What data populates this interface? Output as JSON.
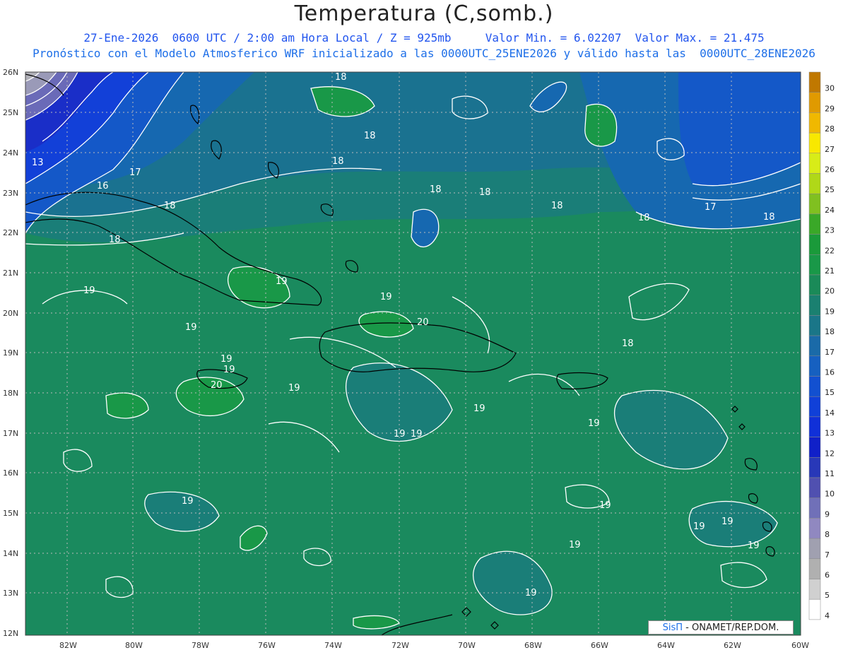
{
  "title": "Temperatura (C,somb.)",
  "subtitle_line1": "27-Ene-2026  0600 UTC / 2:00 am Hora Local / Z = 925mb     Valor Min. = 6.02207  Valor Max. = 21.475",
  "subtitle_line2": "Pronóstico con el Modelo Atmosferico WRF inicializado a las 0000UTC_25ENE2026 y válido hasta las  0000UTC_28ENE2026",
  "credit": {
    "sis": "SisΠ",
    "rest": " - ONAMET/REP.DOM."
  },
  "lat_labels": [
    "26N",
    "25N",
    "24N",
    "23N",
    "22N",
    "21N",
    "20N",
    "19N",
    "18N",
    "17N",
    "16N",
    "15N",
    "14N",
    "13N",
    "12N"
  ],
  "lon_labels": [
    "82W",
    "80W",
    "78W",
    "76W",
    "74W",
    "72W",
    "70W",
    "68W",
    "66W",
    "64W",
    "62W",
    "60W"
  ],
  "colorbar": {
    "levels": [
      "30",
      "29",
      "28",
      "27",
      "26",
      "25",
      "24",
      "23",
      "22",
      "21",
      "20",
      "19",
      "18",
      "17",
      "16",
      "15",
      "14",
      "13",
      "12",
      "11",
      "10",
      "9",
      "8",
      "7",
      "6",
      "5",
      "4"
    ],
    "colors": [
      "#c07800",
      "#e09a00",
      "#f0b800",
      "#f8e800",
      "#d8ec18",
      "#b0d818",
      "#80c020",
      "#3aa828",
      "#1a9a3a",
      "#199848",
      "#1a8a58",
      "#1a8070",
      "#1a7688",
      "#1a6aa8",
      "#1660c0",
      "#1250d0",
      "#1040d8",
      "#1030d8",
      "#1020c8",
      "#2838b8",
      "#5050b0",
      "#7070b8",
      "#9088c0",
      "#a0a0b0",
      "#b0b0b0",
      "#d0d0d0",
      "#ffffff"
    ]
  },
  "contour_labels": [
    {
      "text": "18"
    },
    {
      "text": "18"
    },
    {
      "text": "18"
    },
    {
      "text": "18"
    },
    {
      "text": "18"
    },
    {
      "text": "18"
    },
    {
      "text": "18"
    },
    {
      "text": "18"
    },
    {
      "text": "17"
    },
    {
      "text": "17"
    },
    {
      "text": "16"
    },
    {
      "text": "13"
    },
    {
      "text": "18"
    },
    {
      "text": "18"
    },
    {
      "text": "18"
    },
    {
      "text": "19"
    },
    {
      "text": "19"
    },
    {
      "text": "19"
    },
    {
      "text": "19"
    },
    {
      "text": "19"
    },
    {
      "text": "20"
    },
    {
      "text": "19"
    },
    {
      "text": "20"
    },
    {
      "text": "19"
    },
    {
      "text": "19"
    },
    {
      "text": "19"
    },
    {
      "text": "19"
    },
    {
      "text": "19"
    },
    {
      "text": "19"
    },
    {
      "text": "19"
    },
    {
      "text": "19"
    },
    {
      "text": "19"
    },
    {
      "text": "19"
    },
    {
      "text": "19"
    },
    {
      "text": "18"
    },
    {
      "text": "19"
    },
    {
      "text": "19"
    }
  ]
}
